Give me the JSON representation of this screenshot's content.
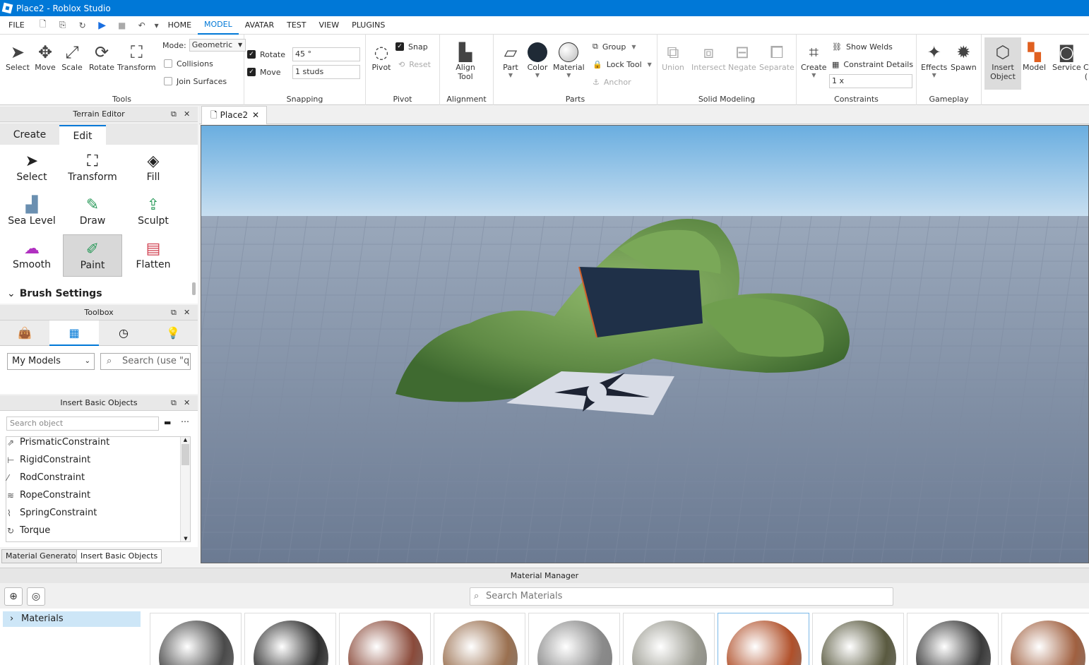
{
  "window": {
    "title": "Place2 - Roblox Studio"
  },
  "menu": {
    "file": "FILE",
    "tabs": [
      "HOME",
      "MODEL",
      "AVATAR",
      "TEST",
      "VIEW",
      "PLUGINS"
    ],
    "active_tab": "MODEL"
  },
  "ribbon": {
    "tools": {
      "label": "Tools",
      "buttons": [
        "Select",
        "Move",
        "Scale",
        "Rotate",
        "Transform"
      ],
      "mode_label": "Mode:",
      "mode_value": "Geometric",
      "collisions": "Collisions",
      "join_surfaces": "Join Surfaces"
    },
    "snapping": {
      "label": "Snapping",
      "rotate_label": "Rotate",
      "rotate_value": "45 °",
      "move_label": "Move",
      "move_value": "1 studs"
    },
    "pivot": {
      "label": "Pivot",
      "button": "Pivot",
      "snap": "Snap",
      "reset": "Reset"
    },
    "alignment": {
      "label": "Alignment",
      "button_line1": "Align",
      "button_line2": "Tool"
    },
    "parts": {
      "label": "Parts",
      "part": "Part",
      "color": "Color",
      "material": "Material",
      "group": "Group",
      "lock_tool": "Lock Tool",
      "anchor": "Anchor"
    },
    "solid_modeling": {
      "label": "Solid Modeling",
      "buttons": [
        "Union",
        "Intersect",
        "Negate",
        "Separate"
      ]
    },
    "constraints": {
      "label": "Constraints",
      "create": "Create",
      "show_welds": "Show Welds",
      "constraint_details": "Constraint Details",
      "scale_value": "1 x"
    },
    "gameplay": {
      "label": "Gameplay",
      "effects": "Effects",
      "spawn": "Spawn"
    },
    "insert": {
      "insert_line1": "Insert",
      "insert_line2": "Object",
      "model": "Model",
      "service": "Service",
      "cut1": "C",
      "cut2": "("
    }
  },
  "terrain_editor": {
    "title": "Terrain Editor",
    "tabs": [
      "Create",
      "Edit"
    ],
    "active_tab": "Edit",
    "tools": [
      "Select",
      "Transform",
      "Fill",
      "Sea Level",
      "Draw",
      "Sculpt",
      "Smooth",
      "Paint",
      "Flatten"
    ],
    "selected_tool": "Paint",
    "brush_settings": "Brush Settings"
  },
  "toolbox": {
    "title": "Toolbox",
    "category": "My Models",
    "search_placeholder": "Search (use \"qu"
  },
  "insert_basic_objects": {
    "title": "Insert Basic Objects",
    "search_placeholder": "Search object",
    "items": [
      "PrismaticConstraint",
      "RigidConstraint",
      "RodConstraint",
      "RopeConstraint",
      "SpringConstraint",
      "Torque"
    ]
  },
  "bottom_tabs": [
    "Material Generator",
    "Insert Basic Objects"
  ],
  "document": {
    "tab": "Place2"
  },
  "material_manager": {
    "title": "Material Manager",
    "search_placeholder": "Search Materials",
    "tree_root": "Materials",
    "swatch_colors": [
      "#4a4a4a",
      "#2e2e2e",
      "#8a4a3a",
      "#9a7050",
      "#8a8a8a",
      "#9a9a90",
      "#b0502a",
      "#5a5a40",
      "#3a3a3a",
      "#a06040"
    ]
  },
  "colors": {
    "accent": "#0078d7",
    "titlebar": "#0078d7"
  }
}
